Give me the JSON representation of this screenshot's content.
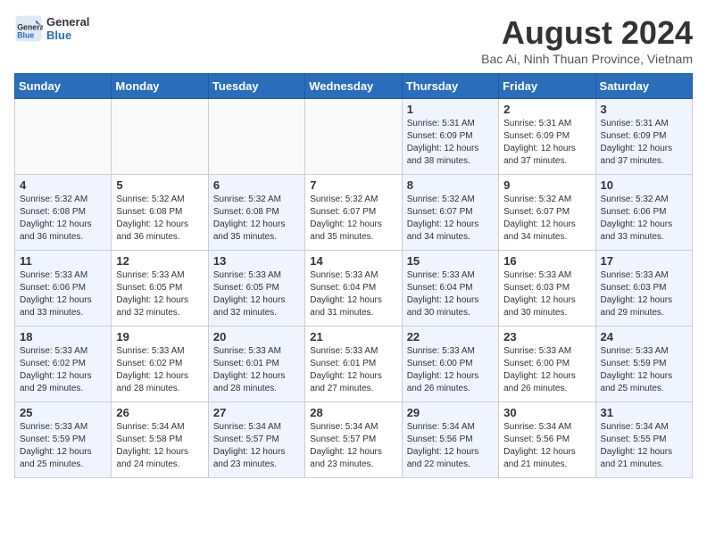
{
  "header": {
    "logo_line1": "General",
    "logo_line2": "Blue",
    "month_title": "August 2024",
    "subtitle": "Bac Ai, Ninh Thuan Province, Vietnam"
  },
  "weekdays": [
    "Sunday",
    "Monday",
    "Tuesday",
    "Wednesday",
    "Thursday",
    "Friday",
    "Saturday"
  ],
  "weeks": [
    [
      {
        "day": "",
        "info": ""
      },
      {
        "day": "",
        "info": ""
      },
      {
        "day": "",
        "info": ""
      },
      {
        "day": "",
        "info": ""
      },
      {
        "day": "1",
        "info": "Sunrise: 5:31 AM\nSunset: 6:09 PM\nDaylight: 12 hours\nand 38 minutes."
      },
      {
        "day": "2",
        "info": "Sunrise: 5:31 AM\nSunset: 6:09 PM\nDaylight: 12 hours\nand 37 minutes."
      },
      {
        "day": "3",
        "info": "Sunrise: 5:31 AM\nSunset: 6:09 PM\nDaylight: 12 hours\nand 37 minutes."
      }
    ],
    [
      {
        "day": "4",
        "info": "Sunrise: 5:32 AM\nSunset: 6:08 PM\nDaylight: 12 hours\nand 36 minutes."
      },
      {
        "day": "5",
        "info": "Sunrise: 5:32 AM\nSunset: 6:08 PM\nDaylight: 12 hours\nand 36 minutes."
      },
      {
        "day": "6",
        "info": "Sunrise: 5:32 AM\nSunset: 6:08 PM\nDaylight: 12 hours\nand 35 minutes."
      },
      {
        "day": "7",
        "info": "Sunrise: 5:32 AM\nSunset: 6:07 PM\nDaylight: 12 hours\nand 35 minutes."
      },
      {
        "day": "8",
        "info": "Sunrise: 5:32 AM\nSunset: 6:07 PM\nDaylight: 12 hours\nand 34 minutes."
      },
      {
        "day": "9",
        "info": "Sunrise: 5:32 AM\nSunset: 6:07 PM\nDaylight: 12 hours\nand 34 minutes."
      },
      {
        "day": "10",
        "info": "Sunrise: 5:32 AM\nSunset: 6:06 PM\nDaylight: 12 hours\nand 33 minutes."
      }
    ],
    [
      {
        "day": "11",
        "info": "Sunrise: 5:33 AM\nSunset: 6:06 PM\nDaylight: 12 hours\nand 33 minutes."
      },
      {
        "day": "12",
        "info": "Sunrise: 5:33 AM\nSunset: 6:05 PM\nDaylight: 12 hours\nand 32 minutes."
      },
      {
        "day": "13",
        "info": "Sunrise: 5:33 AM\nSunset: 6:05 PM\nDaylight: 12 hours\nand 32 minutes."
      },
      {
        "day": "14",
        "info": "Sunrise: 5:33 AM\nSunset: 6:04 PM\nDaylight: 12 hours\nand 31 minutes."
      },
      {
        "day": "15",
        "info": "Sunrise: 5:33 AM\nSunset: 6:04 PM\nDaylight: 12 hours\nand 30 minutes."
      },
      {
        "day": "16",
        "info": "Sunrise: 5:33 AM\nSunset: 6:03 PM\nDaylight: 12 hours\nand 30 minutes."
      },
      {
        "day": "17",
        "info": "Sunrise: 5:33 AM\nSunset: 6:03 PM\nDaylight: 12 hours\nand 29 minutes."
      }
    ],
    [
      {
        "day": "18",
        "info": "Sunrise: 5:33 AM\nSunset: 6:02 PM\nDaylight: 12 hours\nand 29 minutes."
      },
      {
        "day": "19",
        "info": "Sunrise: 5:33 AM\nSunset: 6:02 PM\nDaylight: 12 hours\nand 28 minutes."
      },
      {
        "day": "20",
        "info": "Sunrise: 5:33 AM\nSunset: 6:01 PM\nDaylight: 12 hours\nand 28 minutes."
      },
      {
        "day": "21",
        "info": "Sunrise: 5:33 AM\nSunset: 6:01 PM\nDaylight: 12 hours\nand 27 minutes."
      },
      {
        "day": "22",
        "info": "Sunrise: 5:33 AM\nSunset: 6:00 PM\nDaylight: 12 hours\nand 26 minutes."
      },
      {
        "day": "23",
        "info": "Sunrise: 5:33 AM\nSunset: 6:00 PM\nDaylight: 12 hours\nand 26 minutes."
      },
      {
        "day": "24",
        "info": "Sunrise: 5:33 AM\nSunset: 5:59 PM\nDaylight: 12 hours\nand 25 minutes."
      }
    ],
    [
      {
        "day": "25",
        "info": "Sunrise: 5:33 AM\nSunset: 5:59 PM\nDaylight: 12 hours\nand 25 minutes."
      },
      {
        "day": "26",
        "info": "Sunrise: 5:34 AM\nSunset: 5:58 PM\nDaylight: 12 hours\nand 24 minutes."
      },
      {
        "day": "27",
        "info": "Sunrise: 5:34 AM\nSunset: 5:57 PM\nDaylight: 12 hours\nand 23 minutes."
      },
      {
        "day": "28",
        "info": "Sunrise: 5:34 AM\nSunset: 5:57 PM\nDaylight: 12 hours\nand 23 minutes."
      },
      {
        "day": "29",
        "info": "Sunrise: 5:34 AM\nSunset: 5:56 PM\nDaylight: 12 hours\nand 22 minutes."
      },
      {
        "day": "30",
        "info": "Sunrise: 5:34 AM\nSunset: 5:56 PM\nDaylight: 12 hours\nand 21 minutes."
      },
      {
        "day": "31",
        "info": "Sunrise: 5:34 AM\nSunset: 5:55 PM\nDaylight: 12 hours\nand 21 minutes."
      }
    ]
  ]
}
